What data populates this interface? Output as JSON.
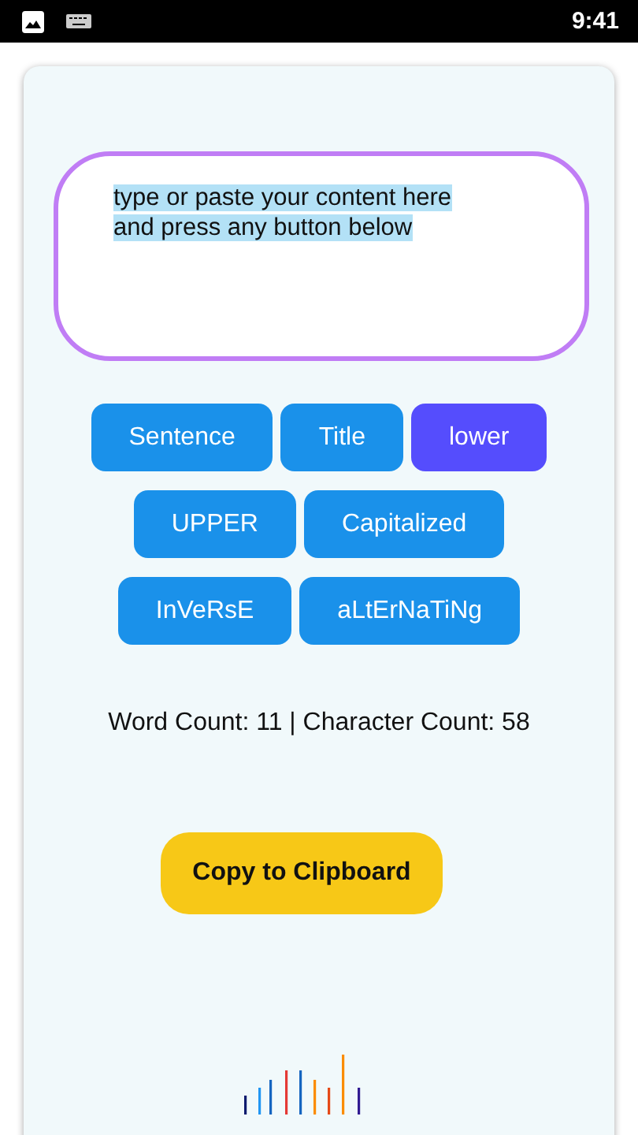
{
  "status_bar": {
    "time": "9:41"
  },
  "input": {
    "value": "type or paste your content here\nand press any button below",
    "text_selected": true
  },
  "case_button_rows": [
    [
      {
        "label": "Sentence",
        "selected": false
      },
      {
        "label": "Title",
        "selected": false
      },
      {
        "label": "lower",
        "selected": true
      }
    ],
    [
      {
        "label": "UPPER",
        "selected": false
      },
      {
        "label": "Capitalized",
        "selected": false
      }
    ],
    [
      {
        "label": "InVeRsE",
        "selected": false
      },
      {
        "label": "aLtErNaTiNg",
        "selected": false
      }
    ]
  ],
  "counts": "Word Count: 11 | Character Count: 58",
  "copy_button": "Copy to Clipboard"
}
